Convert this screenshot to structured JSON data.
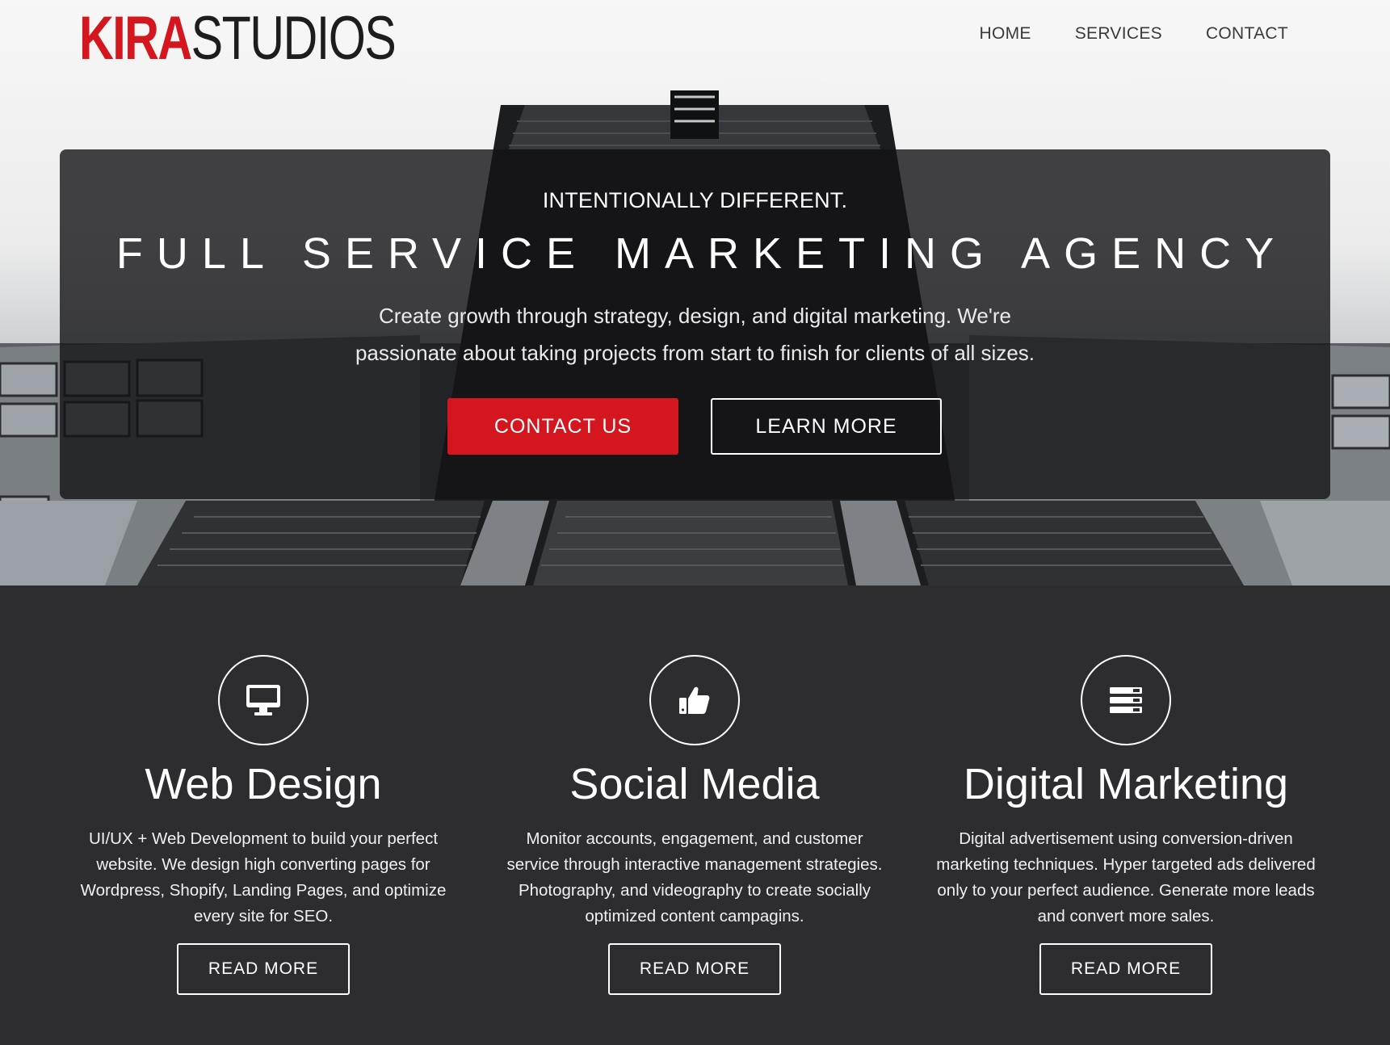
{
  "header": {
    "logo_part1": "KIRA",
    "logo_part2": "STUDIOS",
    "nav": [
      "HOME",
      "SERVICES",
      "CONTACT"
    ]
  },
  "hero": {
    "eyebrow": "INTENTIONALLY DIFFERENT.",
    "headline": "FULL SERVICE MARKETING AGENCY",
    "lead": "Create growth through strategy, design, and digital marketing. We're passionate about taking projects from start to finish for clients of all sizes.",
    "primary_button": "CONTACT US",
    "secondary_button": "LEARN MORE"
  },
  "services": [
    {
      "icon": "monitor-icon",
      "title": "Web Design",
      "text": "UI/UX + Web Development to build your perfect website. We design high converting pages for Wordpress, Shopify, Landing Pages, and optimize every site for SEO.",
      "button": "READ MORE"
    },
    {
      "icon": "thumbs-up-icon",
      "title": "Social Media",
      "text": "Monitor accounts, engagement, and customer service through interactive management strategies. Photography, and videography to create socially optimized content campagins.",
      "button": "READ MORE"
    },
    {
      "icon": "server-icon",
      "title": "Digital Marketing",
      "text": "Digital advertisement using conversion-driven marketing techniques. Hyper targeted ads delivered only to your perfect audience. Generate more leads and convert more sales.",
      "button": "READ MORE"
    }
  ],
  "colors": {
    "brand_red": "#d4161f",
    "dark_bg": "#2d2d2f",
    "text_light": "#ffffff"
  }
}
